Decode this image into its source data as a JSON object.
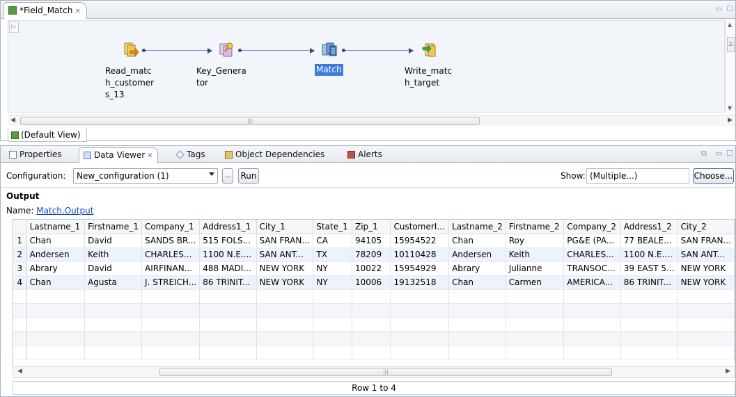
{
  "editor": {
    "tab_title": "*Field_Match",
    "view_tab_label": "(Default View)",
    "nodes": [
      {
        "label": "Read_matc h_customer s_13",
        "icon": "read-icon"
      },
      {
        "label": "Key_Genera tor",
        "icon": "key-generator-icon"
      },
      {
        "label": "Match",
        "icon": "match-icon",
        "selected": true
      },
      {
        "label": "Write_matc h_target",
        "icon": "write-icon"
      }
    ]
  },
  "views": {
    "tabs": [
      {
        "label": "Properties",
        "icon": "properties-icon"
      },
      {
        "label": "Data Viewer",
        "icon": "data-viewer-icon",
        "active": true
      },
      {
        "label": "Tags",
        "icon": "tag-icon"
      },
      {
        "label": "Object Dependencies",
        "icon": "dependencies-icon"
      },
      {
        "label": "Alerts",
        "icon": "alerts-icon"
      }
    ],
    "toolbar": {
      "configuration_label": "Configuration:",
      "configuration_value": "New_configuration (1)",
      "ellipsis_label": "...",
      "run_label": "Run",
      "show_label": "Show:",
      "show_value": "(Multiple...)",
      "choose_label": "Choose..."
    },
    "output": {
      "section_title": "Output",
      "name_label": "Name:",
      "name_link": "Match.Output"
    },
    "table": {
      "columns": [
        "Lastname_1",
        "Firstname_1",
        "Company_1",
        "Address1_1",
        "City_1",
        "State_1",
        "Zip_1",
        "CustomerI...",
        "Lastname_2",
        "Firstname_2",
        "Company_2",
        "Address1_2",
        "City_2"
      ],
      "rows": [
        {
          "num": "1",
          "cells": [
            "Chan",
            "David",
            "SANDS BR...",
            "515 FOLS...",
            "SAN FRAN...",
            "CA",
            "94105",
            "15954522",
            "Chan",
            "Roy",
            "PG&E (PA...",
            "77 BEALE...",
            "SAN FRAN..."
          ]
        },
        {
          "num": "2",
          "cells": [
            "Andersen",
            "Keith",
            "CHARLES...",
            "1100 N.E....",
            "SAN ANT...",
            "TX",
            "78209",
            "10110428",
            "Andersen",
            "Keith",
            "CHARLES...",
            "1100 N.E....",
            "SAN ANT..."
          ]
        },
        {
          "num": "3",
          "cells": [
            "Abrary",
            "David",
            "AIRFINAN...",
            "488 MADI...",
            "NEW YORK",
            "NY",
            "10022",
            "15954929",
            "Abrary",
            "Julianne",
            "TRANSOC...",
            "39 EAST 5...",
            "NEW YORK"
          ]
        },
        {
          "num": "4",
          "cells": [
            "Chan",
            "Agusta",
            "J. STREICH...",
            "86 TRINIT...",
            "NEW YORK",
            "NY",
            "10006",
            "19132518",
            "Chan",
            "Carmen",
            "AMERICA...",
            "86 TRINIT...",
            "NEW YORK"
          ]
        }
      ]
    },
    "row_status": "Row 1 to 4"
  },
  "colors": {
    "selection": "#3d7cdc",
    "link": "#0b46c6",
    "row_stripe": "#edf3fb"
  }
}
